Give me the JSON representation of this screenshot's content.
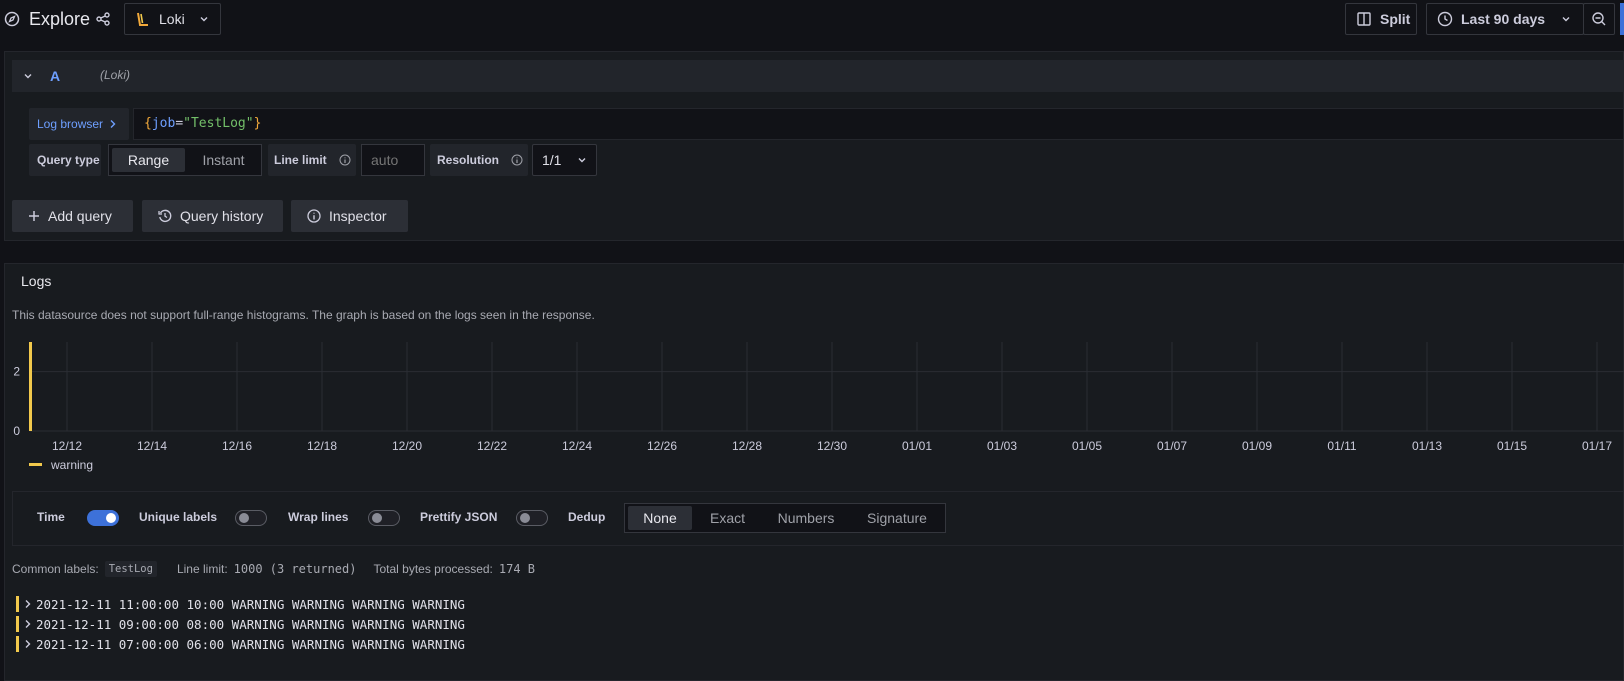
{
  "topbar": {
    "title": "Explore",
    "datasource": "Loki",
    "split_label": "Split",
    "time_range": "Last 90 days"
  },
  "query_row": {
    "ref_id": "A",
    "datasource_hint": "(Loki)",
    "log_browser_label": "Log browser",
    "query": "{job=\"TestLog\"}",
    "query_parts": {
      "open": "{",
      "key": "job",
      "eq": "=",
      "value": "\"TestLog\"",
      "close": "}"
    },
    "query_type_label": "Query type",
    "query_type_options": [
      "Range",
      "Instant"
    ],
    "query_type_selected": "Range",
    "line_limit_label": "Line limit",
    "line_limit_placeholder": "auto",
    "resolution_label": "Resolution",
    "resolution_value": "1/1"
  },
  "actions": {
    "add_query": "Add query",
    "query_history": "Query history",
    "inspector": "Inspector"
  },
  "logs_panel": {
    "title": "Logs",
    "notice": "This datasource does not support full-range histograms. The graph is based on the logs seen in the response."
  },
  "chart_data": {
    "type": "bar",
    "x": [
      "12/11"
    ],
    "series": [
      {
        "name": "warning",
        "values": [
          3
        ],
        "color": "#f2c94c"
      }
    ],
    "x_tick_labels": [
      "12/12",
      "12/14",
      "12/16",
      "12/18",
      "12/20",
      "12/22",
      "12/24",
      "12/26",
      "12/28",
      "12/30",
      "01/01",
      "01/03",
      "01/05",
      "01/07",
      "01/09",
      "01/11",
      "01/13",
      "01/15",
      "01/17"
    ],
    "y_tick_labels": [
      "0",
      "2"
    ],
    "ylim": [
      0,
      3
    ],
    "grid": true,
    "legend": "bottom-left"
  },
  "options": {
    "time_label": "Time",
    "time_on": true,
    "unique_labels_label": "Unique labels",
    "unique_labels_on": false,
    "wrap_lines_label": "Wrap lines",
    "wrap_lines_on": false,
    "prettify_json_label": "Prettify JSON",
    "prettify_json_on": false,
    "dedup_label": "Dedup",
    "dedup_options": [
      "None",
      "Exact",
      "Numbers",
      "Signature"
    ],
    "dedup_selected": "None"
  },
  "meta": {
    "common_labels_label": "Common labels:",
    "common_labels_value": "TestLog",
    "line_limit_label": "Line limit:",
    "line_limit_value": "1000 (3 returned)",
    "total_bytes_label": "Total bytes processed:",
    "total_bytes_value": "174 B"
  },
  "logs": [
    {
      "text": "2021-12-11 11:00:00 10:00 WARNING WARNING WARNING WARNING"
    },
    {
      "text": "2021-12-11 09:00:00 08:00 WARNING WARNING WARNING WARNING"
    },
    {
      "text": "2021-12-11 07:00:00 06:00 WARNING WARNING WARNING WARNING"
    }
  ],
  "colors": {
    "background": "#111217",
    "panel": "#181b1f",
    "accent_blue": "#3d71d9",
    "link_blue": "#6e9fff",
    "warning_yellow": "#f2c94c"
  }
}
